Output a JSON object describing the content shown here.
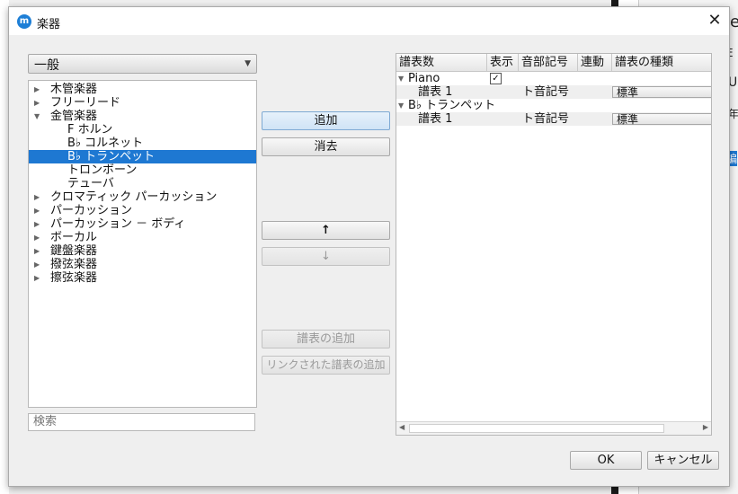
{
  "dialog": {
    "title": "楽器",
    "close_glyph": "✕",
    "app_glyph": "m"
  },
  "category": {
    "selected": "一般"
  },
  "instrument_tree": [
    {
      "label": "木管楽器",
      "level": 0,
      "expanded": false
    },
    {
      "label": "フリーリード",
      "level": 0,
      "expanded": false
    },
    {
      "label": "金管楽器",
      "level": 0,
      "expanded": true
    },
    {
      "label": "F ホルン",
      "level": 1
    },
    {
      "label": "B♭ コルネット",
      "level": 1
    },
    {
      "label": "B♭ トランペット",
      "level": 1,
      "selected": true
    },
    {
      "label": "トロンボーン",
      "level": 1
    },
    {
      "label": "テューバ",
      "level": 1
    },
    {
      "label": "クロマティック パーカッション",
      "level": 0,
      "expanded": false
    },
    {
      "label": "パーカッション",
      "level": 0,
      "expanded": false
    },
    {
      "label": "パーカッション － ボディ",
      "level": 0,
      "expanded": false
    },
    {
      "label": "ボーカル",
      "level": 0,
      "expanded": false
    },
    {
      "label": "鍵盤楽器",
      "level": 0,
      "expanded": false
    },
    {
      "label": "撥弦楽器",
      "level": 0,
      "expanded": false
    },
    {
      "label": "擦弦楽器",
      "level": 0,
      "expanded": false
    }
  ],
  "search": {
    "placeholder": "検索"
  },
  "buttons": {
    "add": "追加",
    "remove": "消去",
    "up": "↑",
    "down": "↓",
    "add_staff": "譜表の追加",
    "add_linked_staff": "リンクされた譜表の追加",
    "ok": "OK",
    "cancel": "キャンセル"
  },
  "staff_table": {
    "columns": [
      "譜表数",
      "表示",
      "音部記号",
      "連動",
      "譜表の種類"
    ],
    "rows": [
      {
        "kind": "instrument",
        "name": "Piano",
        "visible": "✓"
      },
      {
        "kind": "staff",
        "name": "譜表 1",
        "clef": "ト音記号",
        "type": "標準"
      },
      {
        "kind": "instrument",
        "name": "B♭ トランペット"
      },
      {
        "kind": "staff",
        "name": "譜表 1",
        "clef": "ト音記号",
        "type": "標準"
      }
    ]
  },
  "background": {
    "frag_a": "e",
    "frag_b": "E",
    "frag_c": "U",
    "frag_d": "年",
    "frag_e": "編"
  }
}
